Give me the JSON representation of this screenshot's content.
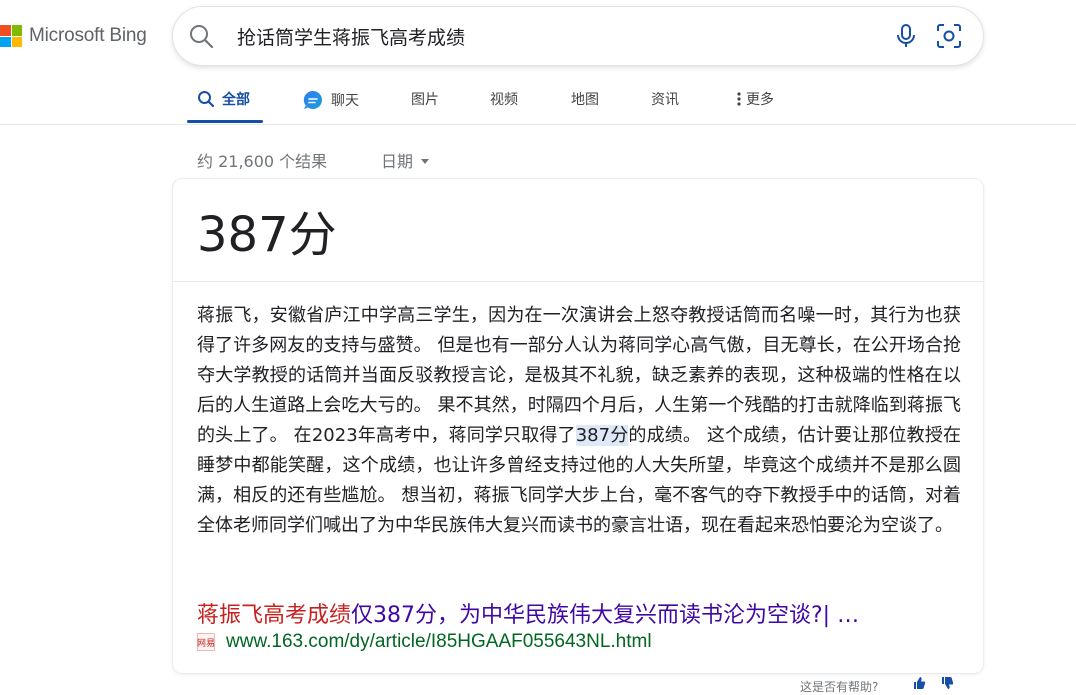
{
  "brand": {
    "name": "Microsoft Bing",
    "colors": [
      "#f25022",
      "#7fba00",
      "#00a4ef",
      "#ffb900"
    ]
  },
  "search": {
    "query": "抢话筒学生蒋振飞高考成绩"
  },
  "nav": {
    "tabs": [
      {
        "label": "全部",
        "icon": "search-icon"
      },
      {
        "label": "聊天",
        "icon": "chat-icon"
      },
      {
        "label": "图片"
      },
      {
        "label": "视频"
      },
      {
        "label": "地图"
      },
      {
        "label": "资讯"
      },
      {
        "label": "更多",
        "icon": "more-icon"
      }
    ]
  },
  "results": {
    "count": "约 21,600 个结果",
    "date_filter": "日期"
  },
  "answer_card": {
    "answer": "387分",
    "snippet_before": "蒋振飞，安徽省庐江中学高三学生，因为在一次演讲会上怒夺教授话筒而名噪一时，其行为也获得了许多网友的支持与盛赞。 但是也有一部分人认为蒋同学心高气傲，目无尊长，在公开场合抢夺大学教授的话筒并当面反驳教授言论，是极其不礼貌，缺乏素养的表现，这种极端的性格在以后的人生道路上会吃大亏的。 果不其然，时隔四个月后，人生第一个残酷的打击就降临到蒋振飞的头上了。 在2023年高考中，蒋同学只取得了",
    "snippet_highlight": "387分",
    "snippet_after": "的成绩。 这个成绩，估计要让那位教授在睡梦中都能笑醒，这个成绩，也让许多曾经支持过他的人大失所望，毕竟这个成绩并不是那么圆满，相反的还有些尴尬。 想当初，蒋振飞同学大步上台，毫不客气的夺下教授手中的话筒，对着全体老师同学们喊出了为中华民族伟大复兴而读书的豪言壮语，现在看起来恐怕要沦为空谈了。",
    "source_title_highlight": "蒋振飞高考成绩",
    "source_title_rest": "仅387分，为中华民族伟大复兴而读书沦为空谈?| …",
    "source_favicon_text": "网易",
    "source_url": "www.163.com/dy/article/I85HGAAF055643NL.html"
  },
  "feedback": {
    "label": "这是否有帮助?"
  },
  "colors": {
    "accent": "#174ea6",
    "link": "#4007a2",
    "url": "#006621",
    "highlight_title": "#c5221f"
  }
}
